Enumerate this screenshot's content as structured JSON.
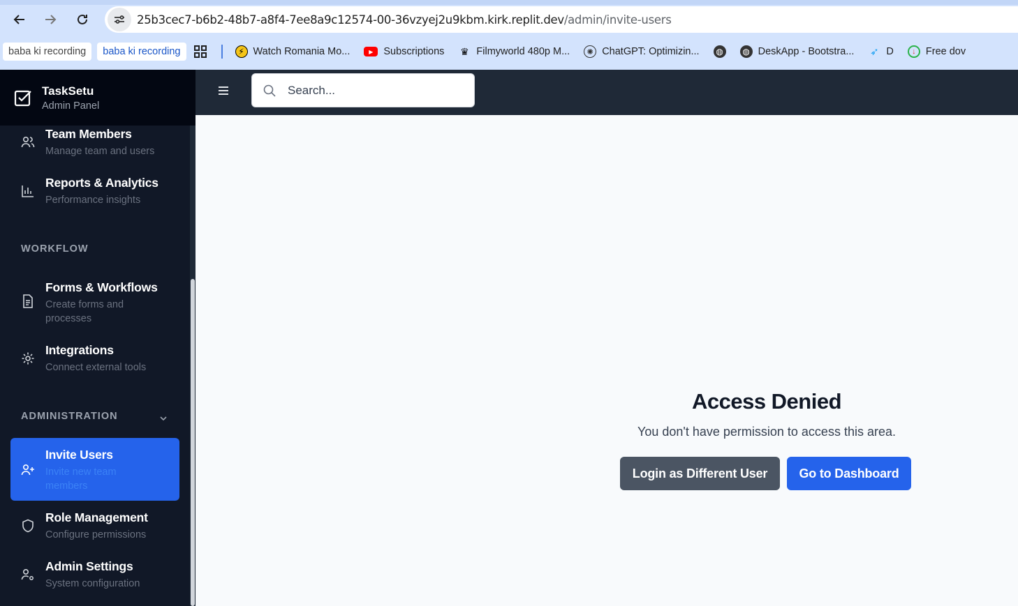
{
  "browser": {
    "url_host": "25b3cec7-b6b2-48b7-a8f4-7ee8a9c12574-00-36vzyej2u9kbm.kirk.replit.dev",
    "url_path": "/admin/invite-users",
    "bookmarks": [
      {
        "label": "baba ki recording",
        "icon": "none"
      },
      {
        "label": "baba ki recording",
        "icon": "none"
      },
      {
        "label": "Watch Romania Mo...",
        "icon": "bolt-icon"
      },
      {
        "label": "Subscriptions",
        "icon": "youtube-icon"
      },
      {
        "label": "Filmyworld 480p M...",
        "icon": "crown-icon"
      },
      {
        "label": "ChatGPT: Optimizin...",
        "icon": "chatgpt-icon"
      },
      {
        "label": "",
        "icon": "globe-icon"
      },
      {
        "label": "DeskApp - Bootstra...",
        "icon": "globe-icon"
      },
      {
        "label": "D",
        "icon": "bird-icon"
      },
      {
        "label": "Free dov",
        "icon": "download-icon"
      }
    ]
  },
  "brand": {
    "title": "TaskSetu",
    "subtitle": "Admin Panel"
  },
  "sidebar": {
    "items_top": [
      {
        "title": "Team Members",
        "desc": "Manage team and users",
        "icon": "users-icon"
      },
      {
        "title": "Reports & Analytics",
        "desc": "Performance insights",
        "icon": "bar-chart-icon"
      }
    ],
    "workflow_label": "WORKFLOW",
    "workflow_items": [
      {
        "title": "Forms & Workflows",
        "desc_line1": "Create forms and",
        "desc_line2": "processes",
        "icon": "file-icon"
      },
      {
        "title": "Integrations",
        "desc": "Connect external tools",
        "icon": "gear-icon"
      }
    ],
    "admin_label": "ADMINISTRATION",
    "admin_items": [
      {
        "title": "Invite Users",
        "desc_line1": "Invite new team",
        "desc_line2": "members",
        "icon": "user-plus-icon",
        "active": true
      },
      {
        "title": "Role Management",
        "desc": "Configure permissions",
        "icon": "shield-icon"
      },
      {
        "title": "Admin Settings",
        "desc": "System configuration",
        "icon": "user-cog-icon"
      }
    ]
  },
  "topbar": {
    "search_placeholder": "Search..."
  },
  "main": {
    "title": "Access Denied",
    "message": "You don't have permission to access this area.",
    "btn_login": "Login as Different User",
    "btn_dashboard": "Go to Dashboard"
  },
  "colors": {
    "accent": "#2563eb",
    "sidebar": "#111827",
    "topbar": "#1f2937",
    "gray_button": "#4b5563"
  }
}
